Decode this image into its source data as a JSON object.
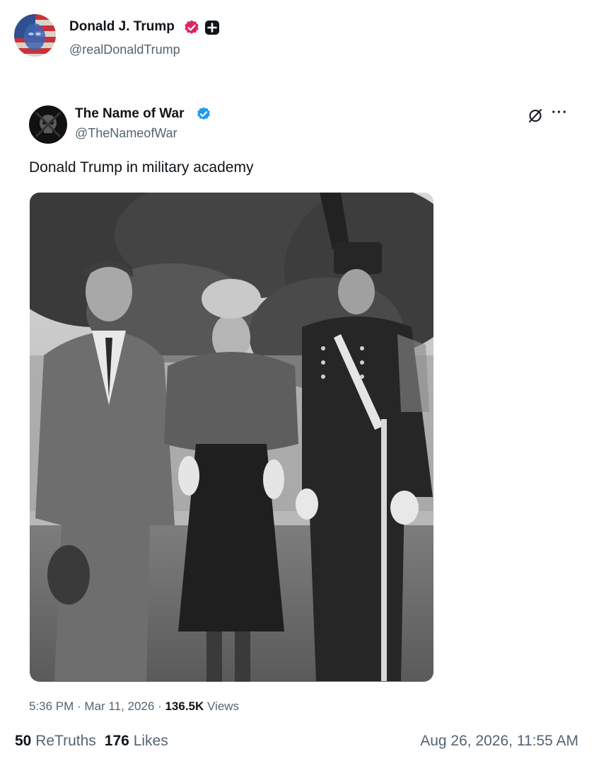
{
  "post": {
    "author_name": "Donald J. Trump",
    "author_handle": "@realDonaldTrump",
    "icons": {
      "avatar": "flag-portrait-avatar",
      "verified": "verified-badge-icon",
      "plus": "plus-badge-icon"
    },
    "colors": {
      "verified_badge": "#e0245e",
      "plus_badge": "#0f1419"
    }
  },
  "quote": {
    "author_name": "The Name of War",
    "author_handle": "@TheNameofWar",
    "text": "Donald Trump in military academy",
    "time": "5:36 PM",
    "date": "Mar 11, 2026",
    "views_count": "136.5K",
    "views_label": "Views",
    "sep1": " · ",
    "sep2": " · ",
    "more_label": "···",
    "icons": {
      "verified": "blue-check-icon",
      "grok": "grok-icon",
      "more": "more-icon"
    },
    "colors": {
      "verified_badge": "#1d9bf0"
    }
  },
  "stats": {
    "retruths_count": "50",
    "retruths_label": "ReTruths",
    "likes_count": "176",
    "likes_label": "Likes",
    "post_date": "Aug 26, 2026, 11:55 AM"
  }
}
